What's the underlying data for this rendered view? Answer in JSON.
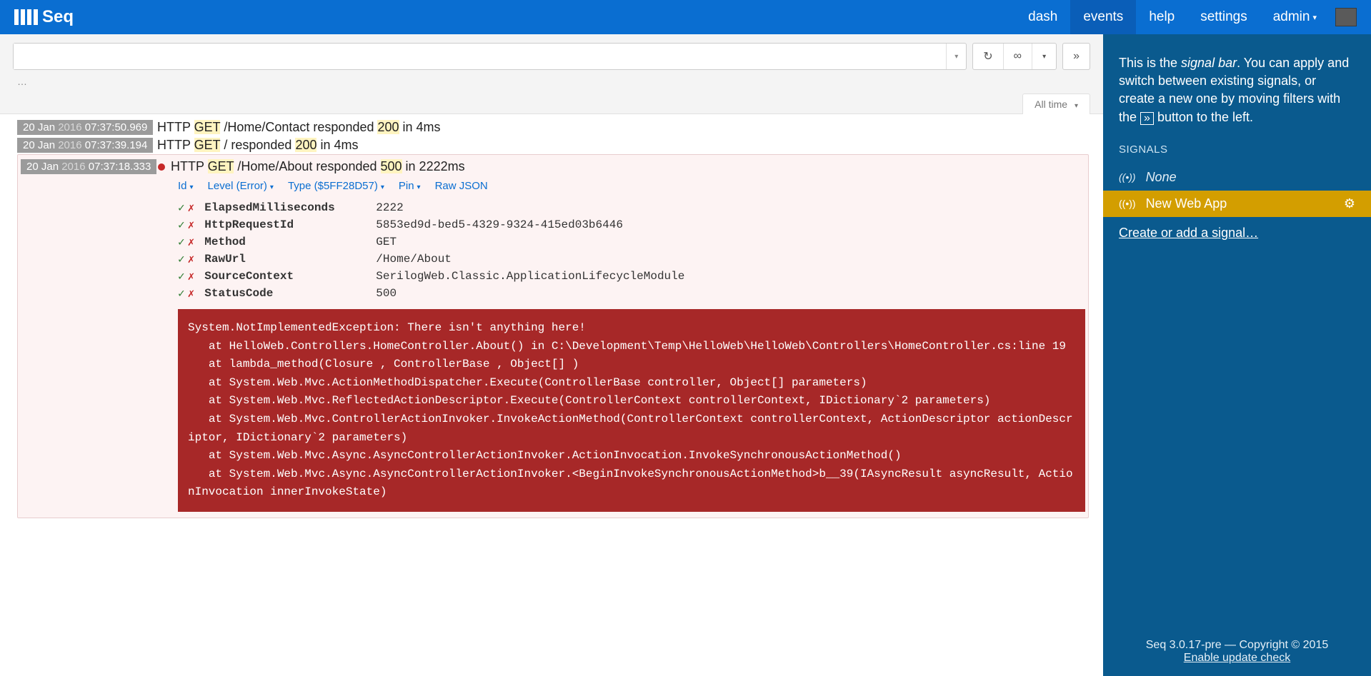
{
  "brand": "Seq",
  "nav": {
    "dash": "dash",
    "events": "events",
    "help": "help",
    "settings": "settings",
    "admin": "admin"
  },
  "toolbar": {
    "crumbs": "…",
    "timeTab": "All time"
  },
  "events": [
    {
      "ts": {
        "d": "20 Jan ",
        "y": "2016",
        "t": "  07:37:50.969"
      },
      "msg_pre": "HTTP ",
      "msg_hl1": "GET",
      "msg_mid": " /Home/Contact responded ",
      "msg_hl2": "200",
      "msg_post": " in 4ms"
    },
    {
      "ts": {
        "d": "20 Jan ",
        "y": "2016",
        "t": "  07:37:39.194"
      },
      "msg_pre": "HTTP ",
      "msg_hl1": "GET",
      "msg_mid": " / responded ",
      "msg_hl2": "200",
      "msg_post": " in 4ms"
    }
  ],
  "expanded": {
    "ts": {
      "d": "20 Jan ",
      "y": "2016",
      "t": "  07:37:18.333"
    },
    "msg_pre": "HTTP ",
    "msg_hl1": "GET",
    "msg_mid": " /Home/About responded ",
    "msg_hl2": "500",
    "msg_post": " in 2222ms",
    "meta": {
      "id": "Id",
      "level": "Level (Error)",
      "type": "Type ($5FF28D57)",
      "pin": "Pin",
      "raw": "Raw JSON"
    },
    "props": [
      {
        "k": "ElapsedMilliseconds",
        "v": "2222"
      },
      {
        "k": "HttpRequestId",
        "v": "5853ed9d-bed5-4329-9324-415ed03b6446"
      },
      {
        "k": "Method",
        "v": "GET"
      },
      {
        "k": "RawUrl",
        "v": "/Home/About"
      },
      {
        "k": "SourceContext",
        "v": "SerilogWeb.Classic.ApplicationLifecycleModule"
      },
      {
        "k": "StatusCode",
        "v": "500"
      }
    ],
    "stack": "System.NotImplementedException: There isn't anything here!\n   at HelloWeb.Controllers.HomeController.About() in C:\\Development\\Temp\\HelloWeb\\HelloWeb\\Controllers\\HomeController.cs:line 19\n   at lambda_method(Closure , ControllerBase , Object[] )\n   at System.Web.Mvc.ActionMethodDispatcher.Execute(ControllerBase controller, Object[] parameters)\n   at System.Web.Mvc.ReflectedActionDescriptor.Execute(ControllerContext controllerContext, IDictionary`2 parameters)\n   at System.Web.Mvc.ControllerActionInvoker.InvokeActionMethod(ControllerContext controllerContext, ActionDescriptor actionDescriptor, IDictionary`2 parameters)\n   at System.Web.Mvc.Async.AsyncControllerActionInvoker.ActionInvocation.InvokeSynchronousActionMethod()\n   at System.Web.Mvc.Async.AsyncControllerActionInvoker.<BeginInvokeSynchronousActionMethod>b__39(IAsyncResult asyncResult, ActionInvocation innerInvokeState)"
  },
  "sidebar": {
    "intro_1": "This is the ",
    "intro_em": "signal bar",
    "intro_2": ". You can apply and switch between existing signals, or create a new one by moving filters with the ",
    "intro_3": " button to the left.",
    "signals_head": "SIGNALS",
    "none": "None",
    "selected": "New Web App",
    "create": "Create or add a signal…",
    "version": "Seq 3.0.17-pre — Copyright © 2015",
    "update": "Enable update check"
  }
}
